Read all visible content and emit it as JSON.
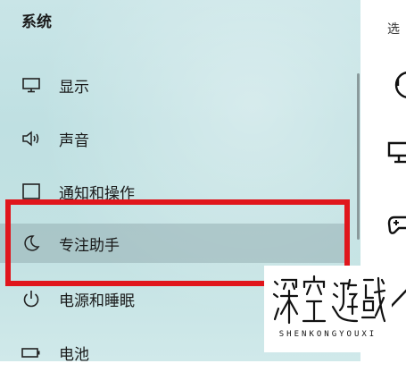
{
  "sidebar": {
    "title": "系统",
    "items": [
      {
        "label": "显示",
        "icon": "monitor-icon"
      },
      {
        "label": "声音",
        "icon": "speaker-icon"
      },
      {
        "label": "通知和操作",
        "icon": "notification-icon"
      },
      {
        "label": "专注助手",
        "icon": "moon-icon",
        "selected": true
      },
      {
        "label": "电源和睡眠",
        "icon": "power-icon"
      },
      {
        "label": "电池",
        "icon": "battery-icon"
      }
    ]
  },
  "right_panel": {
    "text": "选",
    "icons": [
      "info-circle-icon",
      "monitor-icon",
      "gamepad-icon",
      "triangle-icon"
    ]
  },
  "watermark": {
    "characters": [
      "深",
      "空",
      "遊",
      "戲"
    ],
    "subtitle": "SHENKONGYOUXI"
  },
  "colors": {
    "highlight_box": "#e0161c",
    "selected_bg": "#96afb2"
  }
}
